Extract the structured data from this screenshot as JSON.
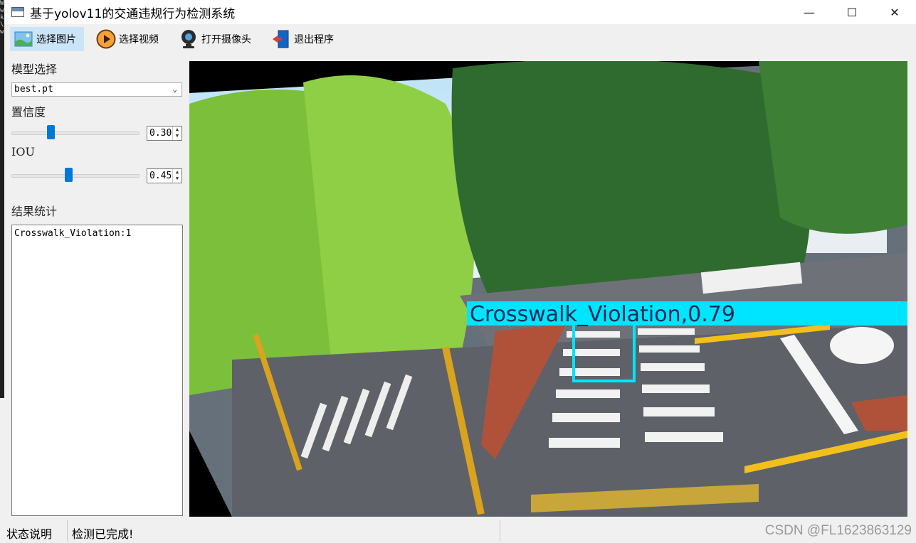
{
  "window": {
    "title": "基于yolov11的交通违规行为检测系统",
    "minimize": "—",
    "maximize": "☐",
    "close": "✕"
  },
  "toolbar": {
    "items": [
      {
        "label": "选择图片",
        "icon": "image-icon"
      },
      {
        "label": "选择视频",
        "icon": "play-icon"
      },
      {
        "label": "打开摄像头",
        "icon": "webcam-icon"
      },
      {
        "label": "退出程序",
        "icon": "exit-door-icon"
      }
    ]
  },
  "panel": {
    "model_label": "模型选择",
    "model_value": "best.pt",
    "confidence_label": "置信度",
    "confidence_value": "0.30",
    "confidence_slider": 0.3,
    "iou_label": "IOU",
    "iou_value": "0.45",
    "iou_slider": 0.45,
    "results_label": "结果统计",
    "results_text": "Crosswalk_Violation:1"
  },
  "detection": {
    "label": "Crosswalk_Violation,0.79",
    "color": "#00e5ff"
  },
  "status": {
    "label": "状态说明",
    "message": "检测已完成!",
    "watermark": "CSDN @FL1623863129"
  },
  "colors": {
    "accent": "#0078d7",
    "toolbar_active": "#cce4f7"
  }
}
